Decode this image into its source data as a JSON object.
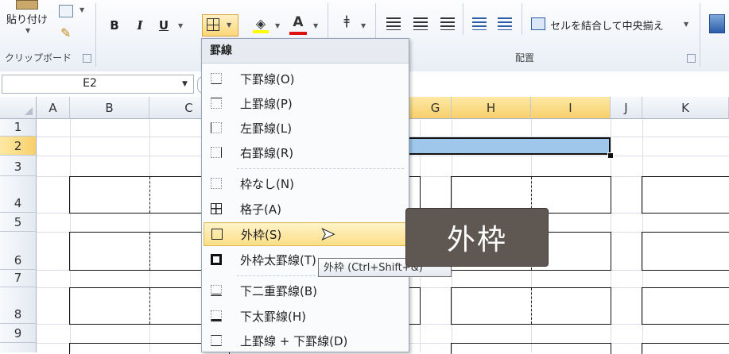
{
  "ribbon": {
    "paste_label": "貼り付け",
    "clipboard_label": "クリップボード",
    "alignment_label": "配置",
    "bold": "B",
    "italic": "I",
    "underline": "U",
    "font_color_letter": "A",
    "merge_center_label": "セルを結合して中央揃え"
  },
  "formula_bar": {
    "name_box": "E2"
  },
  "grid": {
    "columns": [
      "A",
      "B",
      "C",
      "G",
      "H",
      "I",
      "J",
      "K"
    ],
    "rows": [
      "1",
      "2",
      "3",
      "4",
      "5",
      "6",
      "7",
      "8",
      "9"
    ],
    "selected_row": "2",
    "selected_columns": [
      "G",
      "H",
      "I"
    ]
  },
  "border_menu": {
    "title": "罫線",
    "items": [
      {
        "label": "下罫線(O)"
      },
      {
        "label": "上罫線(P)"
      },
      {
        "label": "左罫線(L)"
      },
      {
        "label": "右罫線(R)"
      },
      {
        "label": "枠なし(N)"
      },
      {
        "label": "格子(A)"
      },
      {
        "label": "外枠(S)"
      },
      {
        "label": "外枠太罫線(T)"
      },
      {
        "label": "下二重罫線(B)"
      },
      {
        "label": "下太罫線(H)"
      },
      {
        "label": "上罫線 + 下罫線(D)"
      }
    ]
  },
  "caption": "外枠",
  "tooltip": "外枠 (Ctrl+Shift+&)",
  "colors": {
    "selection_fill": "#9fc7ec",
    "header_selected": "#f8cf6b",
    "menu_highlight": "#fddf88",
    "caption_bg": "#5e5752"
  }
}
